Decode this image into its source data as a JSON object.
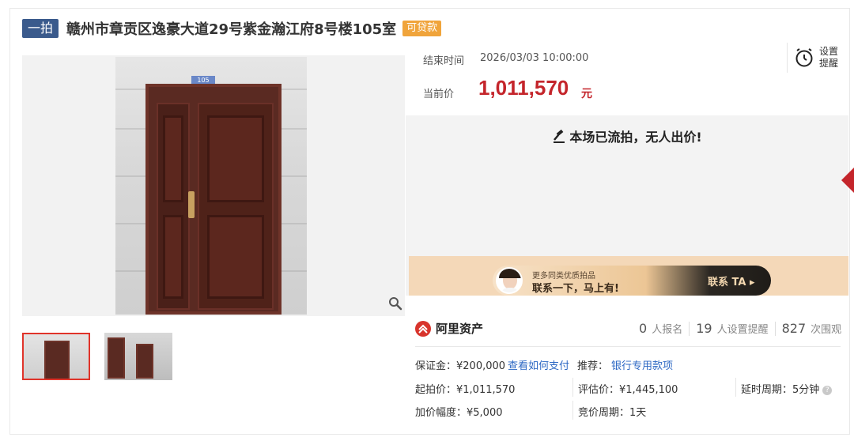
{
  "header": {
    "round_tag": "一拍",
    "title": "赣州市章贡区逸豪大道29号紫金瀚江府8号楼105室",
    "loan_badge": "可贷款"
  },
  "photo": {
    "room_plate": "105"
  },
  "auction": {
    "end_label": "结束时间",
    "end_value": "2026/03/03 10:00:00",
    "price_label": "当前价",
    "price_value": "1,011,570",
    "price_unit": "元",
    "reminder_label": "设置提醒",
    "status_text": "本场已流拍，无人出价!"
  },
  "promo": {
    "line1": "更多同类优质拍品",
    "line2": "联系一下，马上有!",
    "cta": "联系 TA ▸"
  },
  "brand": {
    "name": "阿里资产"
  },
  "stats": [
    {
      "num": "0",
      "label": "人报名"
    },
    {
      "num": "19",
      "label": "人设置提醒"
    },
    {
      "num": "827",
      "label": "次围观"
    }
  ],
  "facts": {
    "deposit": "保证金：¥200,000",
    "how_to_pay": "查看如何支付",
    "recommend_label": "推荐：",
    "recommend_link": "银行专用款项",
    "start_price": "起拍价：¥1,011,570",
    "appraisal": "评估价：¥1,445,100",
    "extension": "延时周期：5分钟",
    "increment": "加价幅度：¥5,000",
    "bid_cycle": "竞价周期：1天"
  },
  "colors": {
    "price_red": "#c4252b",
    "link_blue": "#2d68c4",
    "round_tag_bg": "#3a5a8c",
    "loan_badge_bg": "#f0a43b"
  }
}
